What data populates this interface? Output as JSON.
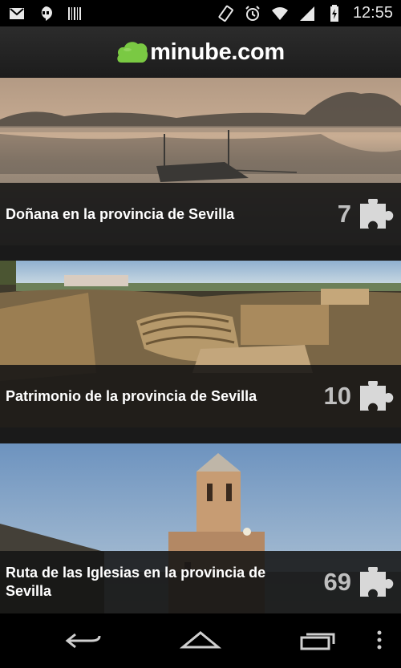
{
  "status_bar": {
    "time": "12:55",
    "left_icons": [
      "gmail-icon",
      "hangouts-icon",
      "barcode-icon"
    ],
    "right_icons": [
      "rotate-icon",
      "alarm-icon",
      "wifi-icon",
      "signal-icon",
      "battery-icon"
    ]
  },
  "header": {
    "logo_text": "minube.com",
    "logo_color": "#7ac943"
  },
  "cards": [
    {
      "title": "Doñana en la provincia de Sevilla",
      "count": "7"
    },
    {
      "title": "Patrimonio de la provincia de Sevilla",
      "count": "10"
    },
    {
      "title": "Ruta de las Iglesias en la provincia de Sevilla",
      "count": "69"
    }
  ],
  "nav": {
    "buttons": [
      "back-icon",
      "home-icon",
      "recents-icon",
      "overflow-menu-icon"
    ]
  }
}
